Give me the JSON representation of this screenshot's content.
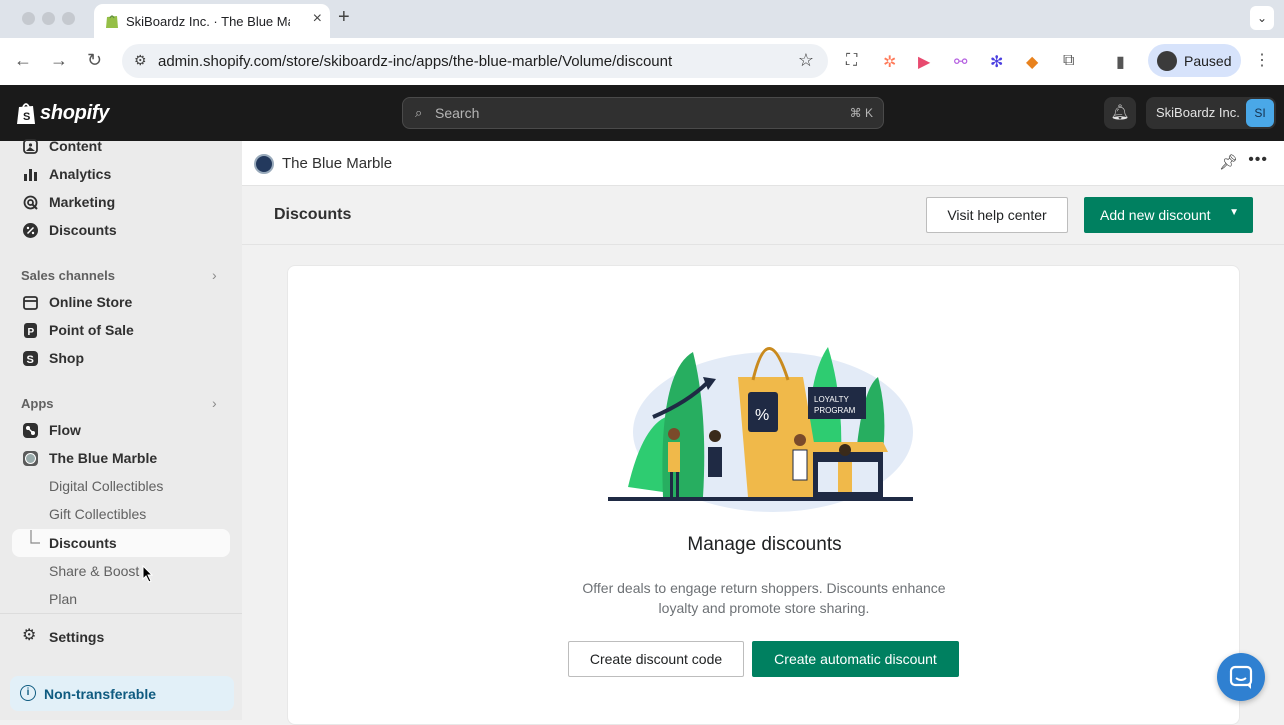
{
  "browser": {
    "tab_title": "SkiBoardz Inc. · The Blue Mar",
    "new_tab_label": "+",
    "url": "admin.shopify.com/store/skiboardz-inc/apps/the-blue-marble/Volume/discount",
    "profile_label": "Paused",
    "icons": [
      "back-icon",
      "forward-icon",
      "reload-icon",
      "site-info-icon",
      "bookmark-star-icon",
      "screenshot-icon",
      "hubspot-icon",
      "extension-icon",
      "extension-icon",
      "extension-icon",
      "metamask-icon",
      "extensions-puzzle-icon",
      "side-panel-icon",
      "menu-icon"
    ]
  },
  "topbar": {
    "logo_text": "shopify",
    "search_placeholder": "Search",
    "search_shortcut": "⌘ K",
    "store_name": "SkiBoardz Inc.",
    "store_initials": "SI"
  },
  "sidebar": {
    "items_top": [
      {
        "label": "Content",
        "icon": "content-icon"
      },
      {
        "label": "Analytics",
        "icon": "analytics-icon"
      },
      {
        "label": "Marketing",
        "icon": "marketing-icon"
      },
      {
        "label": "Discounts",
        "icon": "discounts-icon"
      }
    ],
    "sales_channels_label": "Sales channels",
    "sales_channels": [
      {
        "label": "Online Store",
        "icon": "online-store-icon"
      },
      {
        "label": "Point of Sale",
        "icon": "pos-icon"
      },
      {
        "label": "Shop",
        "icon": "shop-icon"
      }
    ],
    "apps_label": "Apps",
    "apps": [
      {
        "label": "Flow",
        "icon": "flow-icon"
      },
      {
        "label": "The Blue Marble",
        "icon": "blue-marble-icon"
      }
    ],
    "app_subitems": [
      {
        "label": "Digital Collectibles",
        "active": false
      },
      {
        "label": "Gift Collectibles",
        "active": false
      },
      {
        "label": "Discounts",
        "active": true
      },
      {
        "label": "Share & Boost",
        "active": false
      },
      {
        "label": "Plan",
        "active": false
      }
    ],
    "settings_label": "Settings",
    "non_transferable_label": "Non-transferable"
  },
  "app_header": {
    "app_name": "The Blue Marble"
  },
  "page": {
    "title": "Discounts",
    "help_button": "Visit help center",
    "add_button": "Add new discount"
  },
  "empty_state": {
    "illustration_text": [
      "LOYALTY",
      "PROGRAM",
      "%"
    ],
    "heading": "Manage discounts",
    "description": "Offer deals to engage return shoppers. Discounts enhance loyalty and promote store sharing.",
    "primary_action": "Create automatic discount",
    "secondary_action": "Create discount code"
  },
  "colors": {
    "primary_green": "#008060",
    "topbar_bg": "#1a1a1a",
    "sidebar_bg": "#ebebeb",
    "chat_blue": "#2f80d1"
  }
}
